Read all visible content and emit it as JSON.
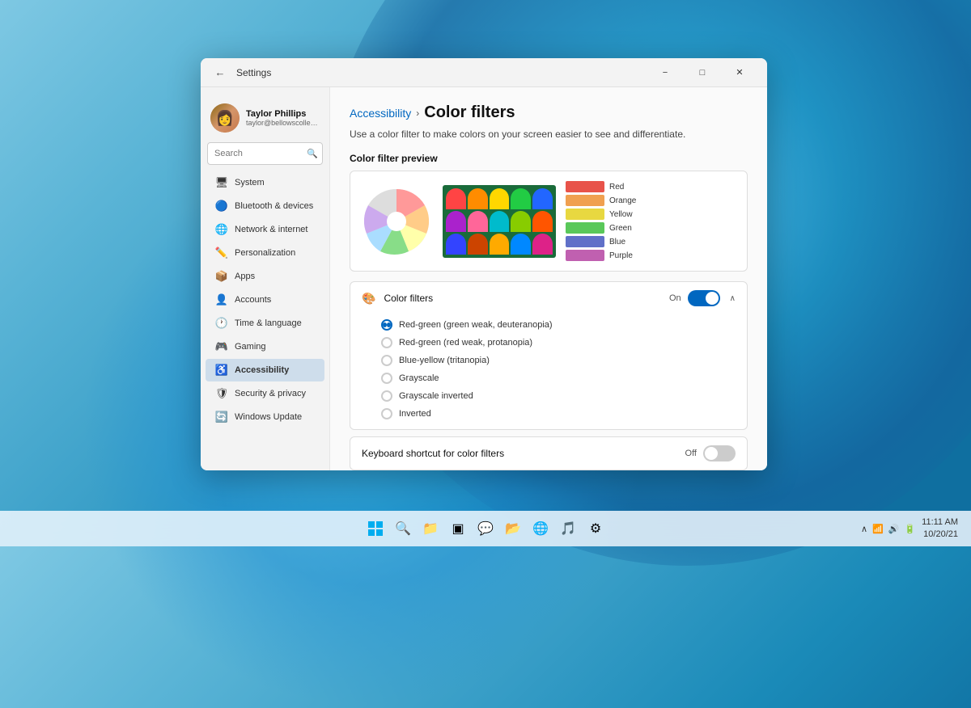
{
  "window": {
    "title": "Settings",
    "back_label": "←",
    "minimize": "−",
    "maximize": "□",
    "close": "✕"
  },
  "user": {
    "name": "Taylor Phillips",
    "email": "taylor@bellowscollege.com",
    "avatar_emoji": "👩"
  },
  "sidebar": {
    "search_placeholder": "Search",
    "items": [
      {
        "id": "system",
        "label": "System",
        "icon": "🖥",
        "active": false
      },
      {
        "id": "bluetooth",
        "label": "Bluetooth & devices",
        "icon": "🔵",
        "active": false
      },
      {
        "id": "network",
        "label": "Network & internet",
        "icon": "🌐",
        "active": false
      },
      {
        "id": "personalization",
        "label": "Personalization",
        "icon": "✏️",
        "active": false
      },
      {
        "id": "apps",
        "label": "Apps",
        "icon": "📦",
        "active": false
      },
      {
        "id": "accounts",
        "label": "Accounts",
        "icon": "👤",
        "active": false
      },
      {
        "id": "time",
        "label": "Time & language",
        "icon": "🕐",
        "active": false
      },
      {
        "id": "gaming",
        "label": "Gaming",
        "icon": "🎮",
        "active": false
      },
      {
        "id": "accessibility",
        "label": "Accessibility",
        "icon": "♿",
        "active": true
      },
      {
        "id": "privacy",
        "label": "Security & privacy",
        "icon": "🛡",
        "active": false
      },
      {
        "id": "update",
        "label": "Windows Update",
        "icon": "🔄",
        "active": false
      }
    ]
  },
  "main": {
    "breadcrumb_parent": "Accessibility",
    "breadcrumb_separator": "›",
    "page_title": "Color filters",
    "description": "Use a color filter to make colors on your screen easier to see and differentiate.",
    "preview_label": "Color filter preview",
    "swatches": [
      {
        "label": "Red",
        "color": "#e8534a"
      },
      {
        "label": "Orange",
        "color": "#f0a050"
      },
      {
        "label": "Yellow",
        "color": "#e8d840"
      },
      {
        "label": "Green",
        "color": "#5ac85a"
      },
      {
        "label": "Blue",
        "color": "#6070c8"
      },
      {
        "label": "Purple",
        "color": "#c060b0"
      }
    ],
    "color_filters": {
      "label": "Color filters",
      "status_on": "On",
      "toggle_state": "on",
      "radio_options": [
        {
          "id": "red_green_deut",
          "label": "Red-green (green weak, deuteranopia)",
          "checked": true
        },
        {
          "id": "red_green_prot",
          "label": "Red-green (red weak, protanopia)",
          "checked": false
        },
        {
          "id": "blue_yellow",
          "label": "Blue-yellow (tritanopia)",
          "checked": false
        },
        {
          "id": "grayscale",
          "label": "Grayscale",
          "checked": false
        },
        {
          "id": "grayscale_inv",
          "label": "Grayscale inverted",
          "checked": false
        },
        {
          "id": "inverted",
          "label": "Inverted",
          "checked": false
        }
      ]
    },
    "keyboard_shortcut": {
      "label": "Keyboard shortcut for color filters",
      "status": "Off",
      "toggle_state": "off"
    }
  },
  "taskbar": {
    "time": "11:11 AM",
    "date": "10/20/21",
    "icons": [
      "⊞",
      "🔍",
      "📁",
      "▣",
      "💬",
      "📂",
      "🌐",
      "🎵",
      "⚙"
    ]
  }
}
